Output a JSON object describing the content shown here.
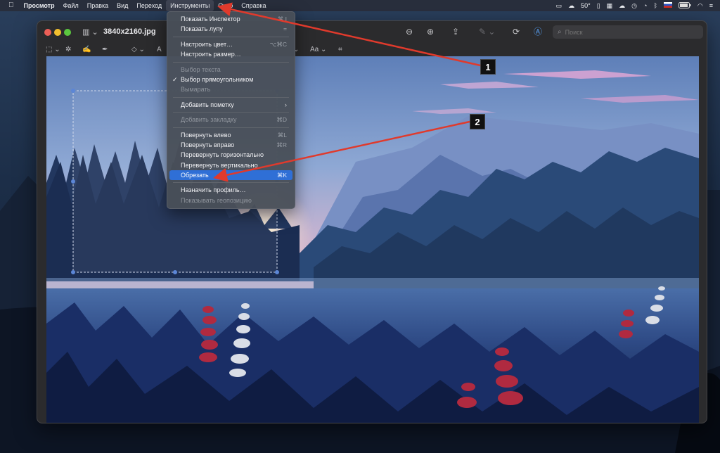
{
  "menubar": {
    "apple": "",
    "items": [
      "Просмотр",
      "Файл",
      "Правка",
      "Вид",
      "Переход",
      "Инструменты",
      "Окно",
      "Справка"
    ],
    "status": {
      "temperature": "50°"
    }
  },
  "window": {
    "title": "3840x2160.jpg",
    "search_placeholder": "Поиск"
  },
  "markup_bar": {
    "text_style_label": "Aa"
  },
  "menu": {
    "items": [
      {
        "label": "Показать Инспектор",
        "shortcut": "⌘ I",
        "disabled": false
      },
      {
        "label": "Показать лупу",
        "shortcut": "=",
        "disabled": false
      },
      {
        "label": "Настроить цвет…",
        "shortcut": "⌥⌘C",
        "disabled": false
      },
      {
        "label": "Настроить размер…",
        "shortcut": "",
        "disabled": false
      },
      {
        "label": "Выбор текста",
        "shortcut": "",
        "disabled": true
      },
      {
        "label": "Выбор прямоугольником",
        "shortcut": "",
        "disabled": false,
        "checked": true
      },
      {
        "label": "Вымарать",
        "shortcut": "",
        "disabled": true
      },
      {
        "label": "Добавить пометку",
        "shortcut": "",
        "disabled": false,
        "submenu": true
      },
      {
        "label": "Добавить закладку",
        "shortcut": "⌘D",
        "disabled": true
      },
      {
        "label": "Повернуть влево",
        "shortcut": "⌘L",
        "disabled": false
      },
      {
        "label": "Повернуть вправо",
        "shortcut": "⌘R",
        "disabled": false
      },
      {
        "label": "Перевернуть горизонтально",
        "shortcut": "",
        "disabled": false
      },
      {
        "label": "Перевернуть вертикально",
        "shortcut": "",
        "disabled": false
      },
      {
        "label": "Обрезать",
        "shortcut": "⌘K",
        "disabled": false,
        "highlighted": true
      },
      {
        "label": "Назначить профиль…",
        "shortcut": "",
        "disabled": false
      },
      {
        "label": "Показывать геопозицию",
        "shortcut": "",
        "disabled": true
      }
    ]
  },
  "annotations": [
    {
      "label": "1"
    },
    {
      "label": "2"
    }
  ],
  "colors": {
    "menu_highlight": "#2f6fd6",
    "arrow": "#e03a2c",
    "close": "#ec5f57",
    "minimize": "#f2bf2f",
    "maximize": "#5bc73f"
  }
}
